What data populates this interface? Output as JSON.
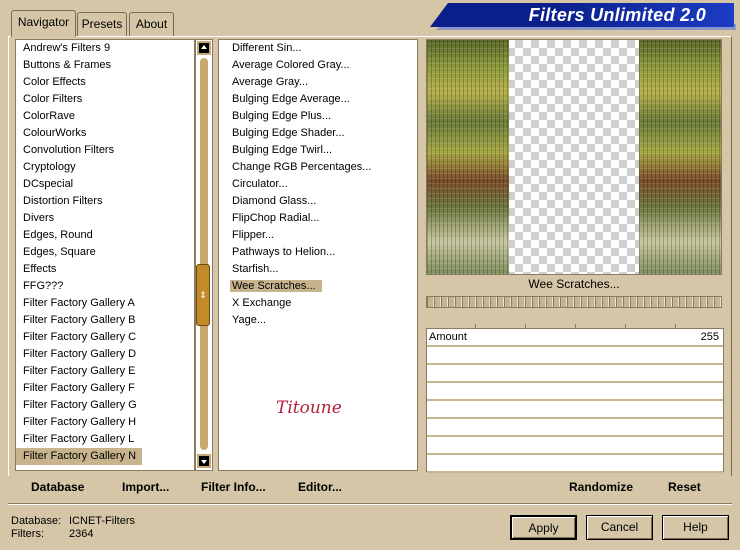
{
  "app": {
    "title": "Filters Unlimited 2.0"
  },
  "tabs": [
    {
      "label": "Navigator",
      "active": true
    },
    {
      "label": "Presets",
      "active": false
    },
    {
      "label": "About",
      "active": false
    }
  ],
  "categories": [
    "Andrew's Filters 9",
    "Buttons & Frames",
    "Color Effects",
    "Color Filters",
    "ColorRave",
    "ColourWorks",
    "Convolution Filters",
    "Cryptology",
    "DCspecial",
    "Distortion Filters",
    "Divers",
    "Edges, Round",
    "Edges, Square",
    "Effects",
    "FFG???",
    "Filter Factory Gallery A",
    "Filter Factory Gallery B",
    "Filter Factory Gallery C",
    "Filter Factory Gallery D",
    "Filter Factory Gallery E",
    "Filter Factory Gallery F",
    "Filter Factory Gallery G",
    "Filter Factory Gallery H",
    "Filter Factory Gallery L",
    "Filter Factory Gallery N"
  ],
  "selected_category": "Filter Factory Gallery N",
  "scrollbar": {
    "thumb_glyph": "⇕"
  },
  "filters": [
    "Different Sin...",
    "Average Colored Gray...",
    "Average Gray...",
    "Bulging Edge Average...",
    "Bulging Edge Plus...",
    "Bulging Edge Shader...",
    "Bulging Edge Twirl...",
    "Change RGB Percentages...",
    "Circulator...",
    "Diamond Glass...",
    "FlipChop Radial...",
    "Flipper...",
    "Pathways to Helion...",
    "Starfish...",
    "Wee Scratches...",
    "X Exchange",
    "Yage..."
  ],
  "selected_filter": "Wee Scratches...",
  "watermark": "Titoune",
  "preview": {
    "label": "Wee Scratches..."
  },
  "params": [
    {
      "name": "Amount",
      "value": "255"
    }
  ],
  "links": {
    "database": "Database",
    "import": "Import...",
    "filter_info": "Filter Info...",
    "editor": "Editor...",
    "randomize": "Randomize",
    "reset": "Reset"
  },
  "status": {
    "database_label": "Database:",
    "database_value": "ICNET-Filters",
    "filters_label": "Filters:",
    "filters_value": "2364"
  },
  "buttons": {
    "apply": "Apply",
    "cancel": "Cancel",
    "help": "Help"
  },
  "colors": {
    "background": "#d6c6a8",
    "banner": "#0a1f8a",
    "selection": "#c7b48d",
    "watermark": "#b51f3a"
  }
}
